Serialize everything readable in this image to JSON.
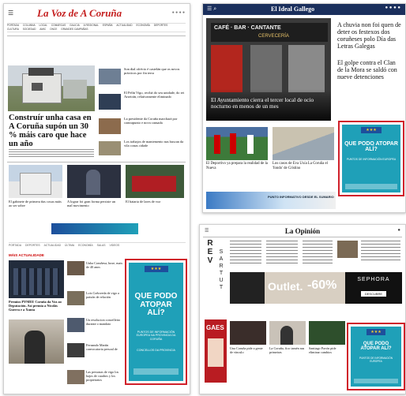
{
  "left_page": {
    "masthead": "La Voz de A Coruña",
    "menu_icon": "menu-icon",
    "nav_items": [
      "PORTADA",
      "COLUNNA",
      "LOCAL",
      "COMARCAS",
      "GALICIA",
      "A REGIONAL",
      "ESPAÑA",
      "ACTUALIDAD",
      "ECONOMÍA",
      "DEPORTES",
      "CULTURA",
      "SOCIEDAD",
      "AMIC",
      "ONCE",
      "GRANDES CAMPAÑAS"
    ],
    "main_headline": "Construír unha casa en A Coruña supón un 30 % máis caro que hace un año",
    "side_headlines": [
      "Son dial ofrécio é castelán que os novos prácticos por fin terra",
      "El Pelín Vigo, recibá do seu unidade, do rei Arseirán, relativamente eliminado",
      "La presidente da Coruña marchará por contrapunto e nova cansada",
      "Los trabajos de mantemento nas buscan da vila conas cidade"
    ],
    "bottom_headlines": [
      "El gabinete de primera ñas cosas máis ao ser sobre",
      "A lograr foi gran forma persiste un mal movimento",
      "El bataria de lares de voz"
    ],
    "tabs": [
      "PORTADA",
      "DEPORTES",
      "ACTUALIDAD",
      "ÚLTIMA",
      "ECONOMÍA",
      "SALAS",
      "VIDEOS"
    ],
    "section_label": "MÁIS ACTUALIDADE",
    "story_headlines": [
      "Premios PYMEE Coruña da Voz ao Deputación. Así premia a Nicolás Guerra e a Xunta",
      "Unha Coruñesa, hoxe, mais de 40 anos",
      "Lois Coñoveda de vigo a paixón de relación",
      "Un resolucion concelleiro durante o mandato",
      "Fernando Martín convocatoria persoal de",
      "Las personas de vigo los bajos de cuadros y los propietarios"
    ],
    "ad_title": "QUE PODO ATOPAR ALÍ?",
    "ad_body": "PUNTOS DE INFORMACIÓN EUROPEA NA PROVINCIA DA CORUÑA",
    "ad_footer": "CONCELLOS DA PROVINCIA"
  },
  "top_right_page": {
    "masthead": "El Ideal Gallego",
    "shop_sign": "CAFÉ · BAR · CANTANTE",
    "shop_sub": "CERVECERÍA",
    "photo_headline": "El Ayuntamiento cierra el tercer local de ocio nocturno en menos de un mes",
    "side_headline_1": "A chuvia non foi quen de deter os festexos dos coruñeses polo Día das Letras Galegas",
    "side_headline_2": "El golpe contra el Clan de la Mora se saldó con nueve detenciones",
    "bottom_headline_1": "El Deportivo ya prepara la realidad de la Nueva",
    "bottom_headline_2": "Los casos de Eva Uxía La Coruña el 'fondo' de Cristino",
    "ad_title": "QUE PODO ATOPAR ALÍ?",
    "ad_body": "PUNTOS DE INFORMACIÓN EUROPEA",
    "bottom_banner": "PUNTO INFORMATIVO DESDE EL SUMARIO"
  },
  "bottom_right_page": {
    "masthead": "La Opinión",
    "revista_letters": [
      "R",
      "E",
      "V",
      "I",
      "S",
      "T",
      "A"
    ],
    "revista_letters_b": [
      "S",
      "A",
      "R",
      "T",
      "U",
      "T"
    ],
    "sephora": "SEPHORA",
    "sephora_sub": "DESCUBRE",
    "outlet": "Outlet.",
    "outlet_pct": "-60%",
    "gaes": "GAES",
    "ad_title": "QUE PODO ATOPAR ALÍ?",
    "ad_body": "PUNTOS DE INFORMACIÓN EUROPEA",
    "headlines": [
      "Una Coruña pide a gente de vínculo",
      "La Coruña, fico tamén nas primeiras",
      "Santiago Pavón pide eliminar cambios"
    ]
  },
  "colors": {
    "highlight_border": "#d0202a",
    "ad_background": "#1fa0b8",
    "eu_blue": "#1d4f9c",
    "masthead_red": "#c41e1e",
    "header_blue": "#1a2f5c"
  }
}
